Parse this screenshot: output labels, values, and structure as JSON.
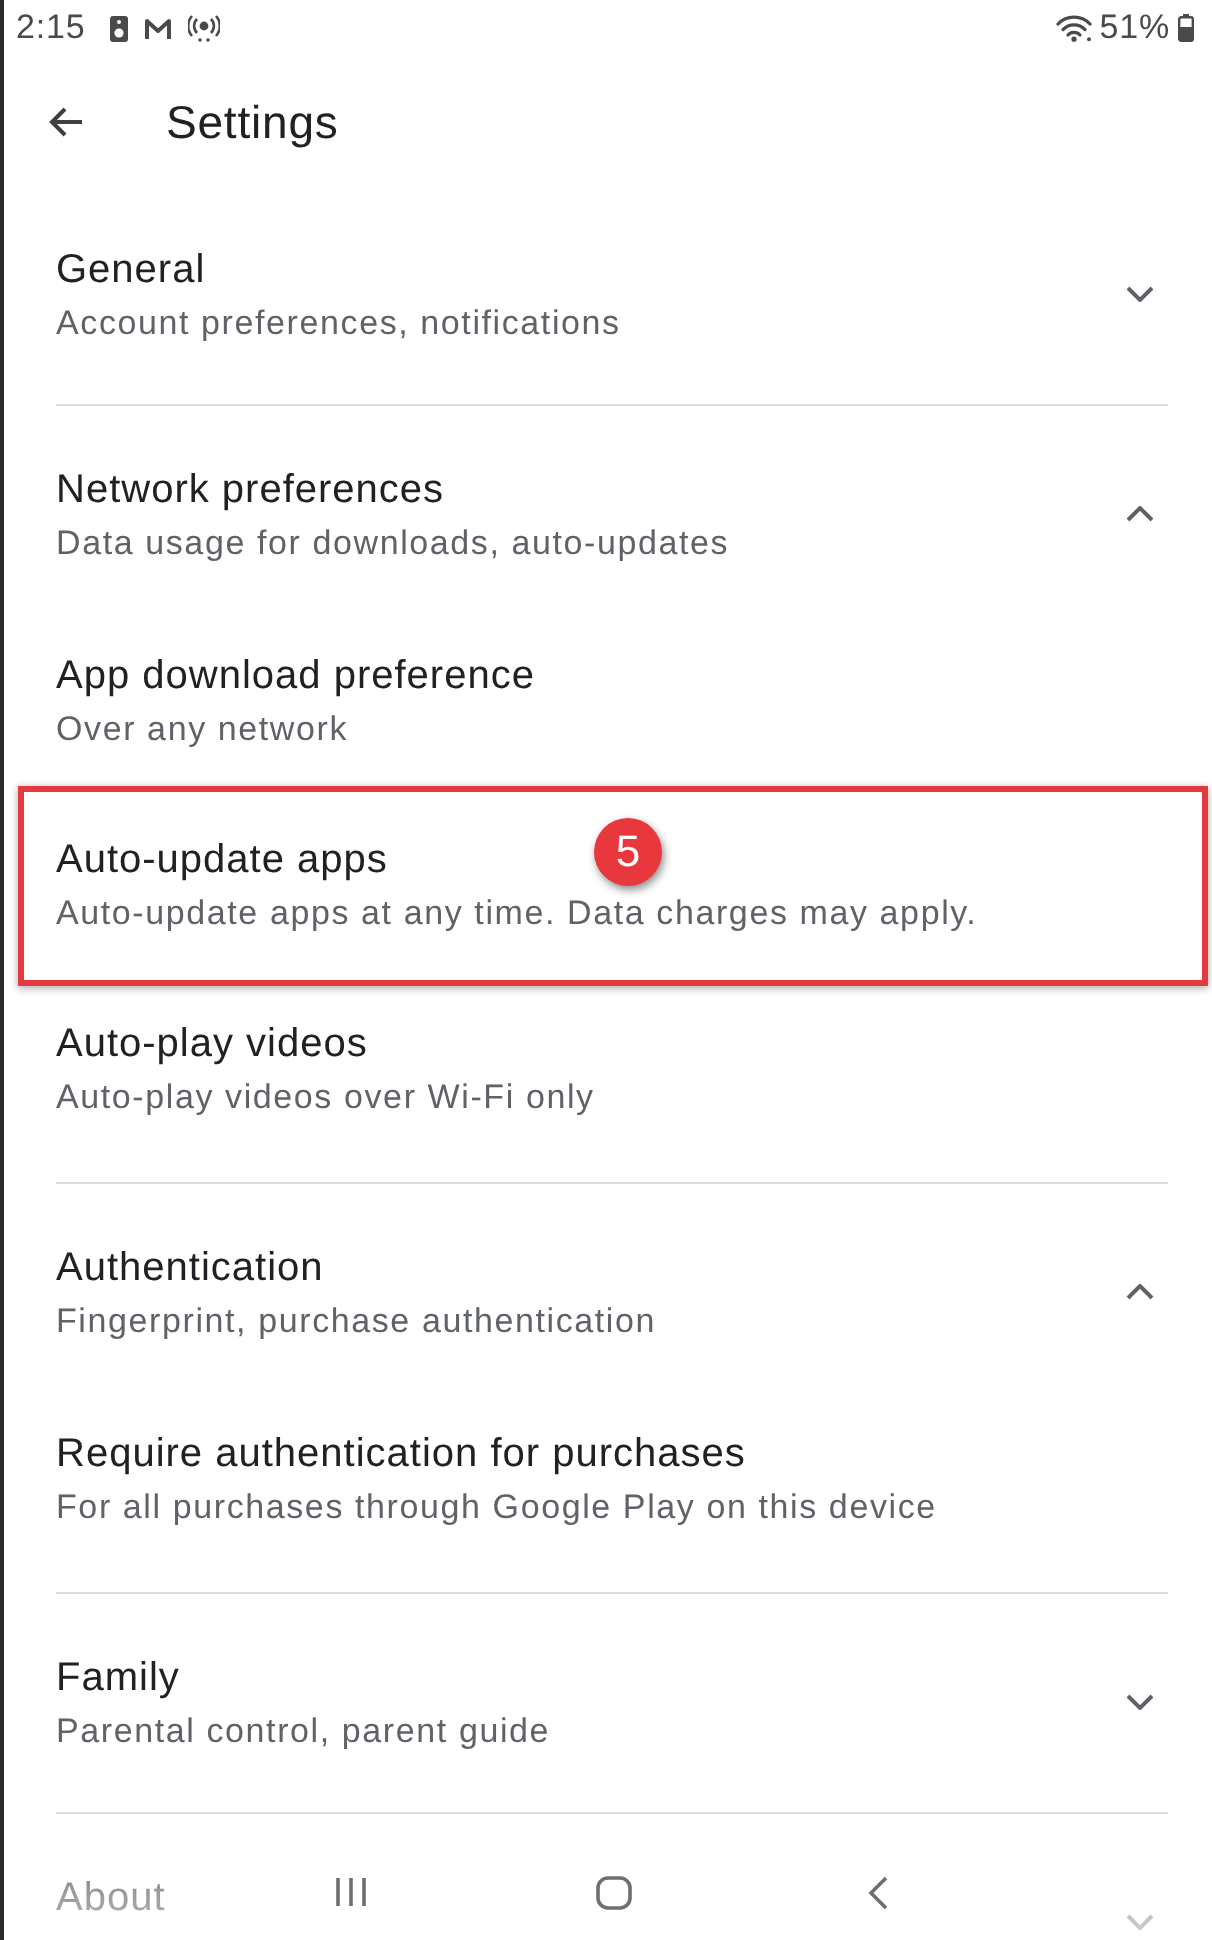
{
  "status_bar": {
    "time": "2:15",
    "battery": "51%"
  },
  "header": {
    "title": "Settings"
  },
  "sections": [
    {
      "title": "General",
      "subtitle": "Account preferences, notifications",
      "expanded": false
    },
    {
      "title": "Network preferences",
      "subtitle": "Data usage for downloads, auto-updates",
      "expanded": true,
      "items": [
        {
          "title": "App download preference",
          "subtitle": "Over any network",
          "highlighted": false
        },
        {
          "title": "Auto-update apps",
          "subtitle": "Auto-update apps at any time. Data charges may apply.",
          "highlighted": true,
          "callout": "5"
        },
        {
          "title": "Auto-play videos",
          "subtitle": "Auto-play videos over Wi-Fi only",
          "highlighted": false
        }
      ]
    },
    {
      "title": "Authentication",
      "subtitle": "Fingerprint, purchase authentication",
      "expanded": true,
      "items": [
        {
          "title": "Require authentication for purchases",
          "subtitle": "For all purchases through Google Play on this device",
          "highlighted": false
        }
      ]
    },
    {
      "title": "Family",
      "subtitle": "Parental control, parent guide",
      "expanded": false
    },
    {
      "title": "About",
      "expanded": false
    }
  ]
}
